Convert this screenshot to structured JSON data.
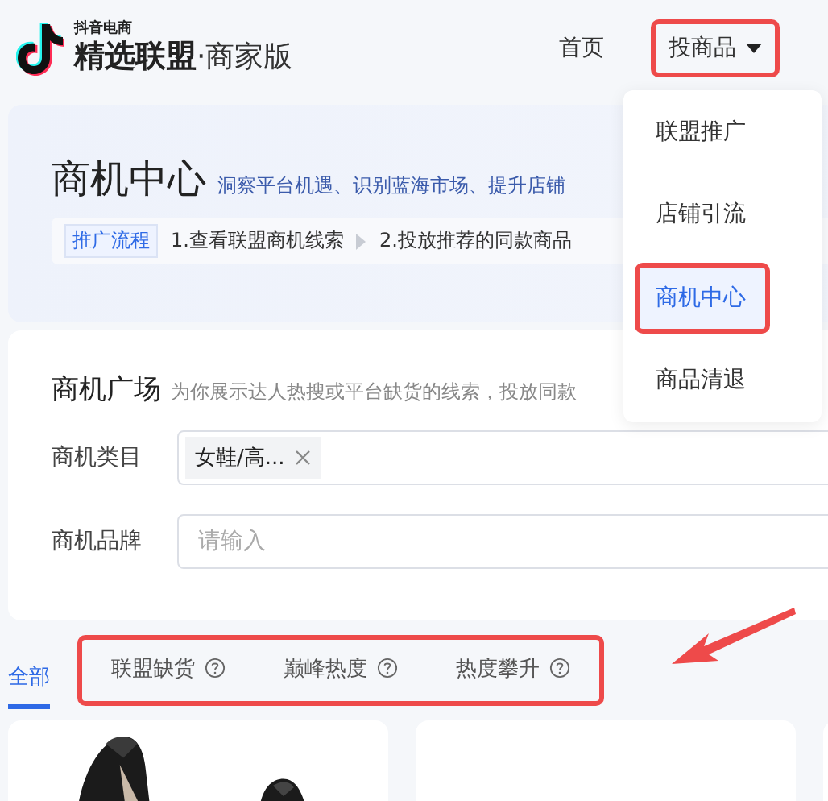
{
  "header": {
    "brand_small": "抖音电商",
    "brand_main": "精选联盟",
    "brand_sub": "·商家版",
    "nav": [
      {
        "label": "首页",
        "dropdown": false,
        "annotated": false
      },
      {
        "label": "投商品",
        "dropdown": true,
        "annotated": true
      }
    ]
  },
  "menu": {
    "items": [
      {
        "label": "联盟推广",
        "selected": false,
        "annotated": false
      },
      {
        "label": "店铺引流",
        "selected": false,
        "annotated": false
      },
      {
        "label": "商机中心",
        "selected": true,
        "annotated": true
      },
      {
        "label": "商品清退",
        "selected": false,
        "annotated": false
      }
    ]
  },
  "hero": {
    "title": "商机中心",
    "subtitle": "洞察平台机遇、识别蓝海市场、提升店铺",
    "flow_tag": "推广流程",
    "steps": [
      "1.查看联盟商机线索",
      "2.投放推荐的同款商品"
    ]
  },
  "square": {
    "title": "商机广场",
    "description": "为你展示达人热搜或平台缺货的线索，投放同款",
    "filters": [
      {
        "label": "商机类目",
        "kind": "tags",
        "tags": [
          "女鞋/高..."
        ]
      },
      {
        "label": "商机品牌",
        "kind": "input",
        "placeholder": "请输入"
      }
    ]
  },
  "filter_tabs": {
    "annotated": true,
    "items": [
      {
        "label": "全部",
        "selected": true,
        "help": false
      },
      {
        "label": "联盟缺货",
        "selected": false,
        "help": true
      },
      {
        "label": "巅峰热度",
        "selected": false,
        "help": true
      },
      {
        "label": "热度攀升",
        "selected": false,
        "help": true
      }
    ]
  },
  "cards": [
    {
      "kind": "picture"
    },
    {
      "kind": "blank"
    },
    {
      "kind": "blank"
    }
  ]
}
